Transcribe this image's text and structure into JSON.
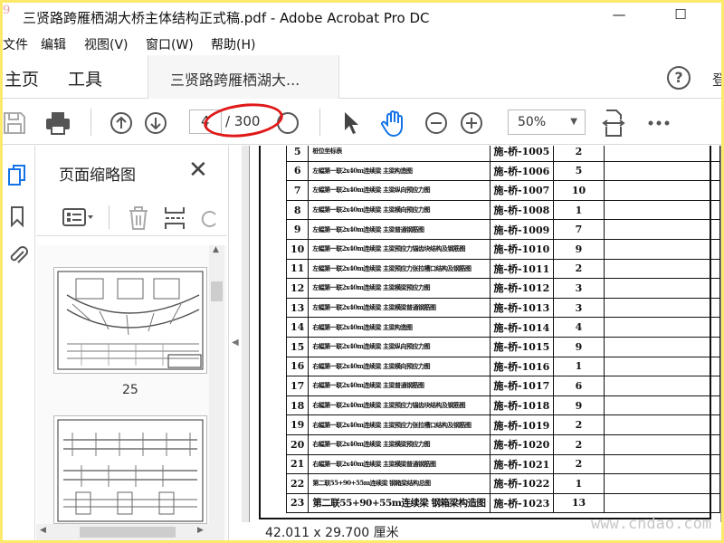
{
  "window": {
    "title": "三贤路跨雁栖湖大桥主体结构正式稿.pdf - Adobe Acrobat Pro DC",
    "watermark_corner": "9",
    "minimize": "—",
    "maximize": "☐"
  },
  "menu": [
    "文件",
    "编辑",
    "视图(V)",
    "窗口(W)",
    "帮助(H)"
  ],
  "tabs": {
    "home": "主页",
    "tools": "工具",
    "document": "三贤路跨雁栖湖大...",
    "help": "?",
    "login": "登"
  },
  "toolbar": {
    "page_current": "4",
    "page_total": "/ 300",
    "zoom": "50%"
  },
  "sidebar": {
    "panel_title": "页面缩略图",
    "thumbnails": [
      {
        "label": "25"
      }
    ]
  },
  "document": {
    "rows": [
      {
        "no": "5",
        "name": "桩位坐标表",
        "code": "施-桥-1005",
        "count": "2"
      },
      {
        "no": "6",
        "name": "左幅第一联2x40m连续梁 主梁构造图",
        "code": "施-桥-1006",
        "count": "5"
      },
      {
        "no": "7",
        "name": "左幅第一联2x40m连续梁 主梁纵向预应力图",
        "code": "施-桥-1007",
        "count": "10"
      },
      {
        "no": "8",
        "name": "左幅第一联2x40m连续梁 主梁横向预应力图",
        "code": "施-桥-1008",
        "count": "1"
      },
      {
        "no": "9",
        "name": "左幅第一联2x40m连续梁 主梁普通钢筋图",
        "code": "施-桥-1009",
        "count": "7"
      },
      {
        "no": "10",
        "name": "左幅第一联2x40m连续梁 主梁预应力锚齿块结构及钢筋图",
        "code": "施-桥-1010",
        "count": "9"
      },
      {
        "no": "11",
        "name": "左幅第一联2x40m连续梁 主梁预应力张拉槽口结构及钢筋图",
        "code": "施-桥-1011",
        "count": "2"
      },
      {
        "no": "12",
        "name": "左幅第一联2x40m连续梁 主梁横梁预应力图",
        "code": "施-桥-1012",
        "count": "3"
      },
      {
        "no": "13",
        "name": "左幅第一联2x40m连续梁 主梁横梁普通钢筋图",
        "code": "施-桥-1013",
        "count": "3"
      },
      {
        "no": "14",
        "name": "右幅第一联2x40m连续梁 主梁构造图",
        "code": "施-桥-1014",
        "count": "4"
      },
      {
        "no": "15",
        "name": "右幅第一联2x40m连续梁 主梁纵向预应力图",
        "code": "施-桥-1015",
        "count": "9"
      },
      {
        "no": "16",
        "name": "右幅第一联2x40m连续梁 主梁横向预应力图",
        "code": "施-桥-1016",
        "count": "1"
      },
      {
        "no": "17",
        "name": "右幅第一联2x40m连续梁 主梁普通钢筋图",
        "code": "施-桥-1017",
        "count": "6"
      },
      {
        "no": "18",
        "name": "右幅第一联2x40m连续梁 主梁预应力锚齿块结构及钢筋图",
        "code": "施-桥-1018",
        "count": "9"
      },
      {
        "no": "19",
        "name": "右幅第一联2x40m连续梁 主梁预应力张拉槽口结构及钢筋图",
        "code": "施-桥-1019",
        "count": "2"
      },
      {
        "no": "20",
        "name": "右幅第一联2x40m连续梁 主梁横梁预应力图",
        "code": "施-桥-1020",
        "count": "2"
      },
      {
        "no": "21",
        "name": "右幅第一联2x40m连续梁 主梁横梁普通钢筋图",
        "code": "施-桥-1021",
        "count": "2"
      },
      {
        "no": "22",
        "name": "第二联55+90+55m连续梁 钢箱梁结构总图",
        "code": "施-桥-1022",
        "count": "1"
      },
      {
        "no": "23",
        "name": "第二联55+90+55m连续梁 钢箱梁构造图",
        "code": "施-桥-1023",
        "count": "13"
      }
    ]
  },
  "status": {
    "page_size": "42.011 x 29.700 厘米"
  },
  "watermark_br": "www.cndao.com"
}
